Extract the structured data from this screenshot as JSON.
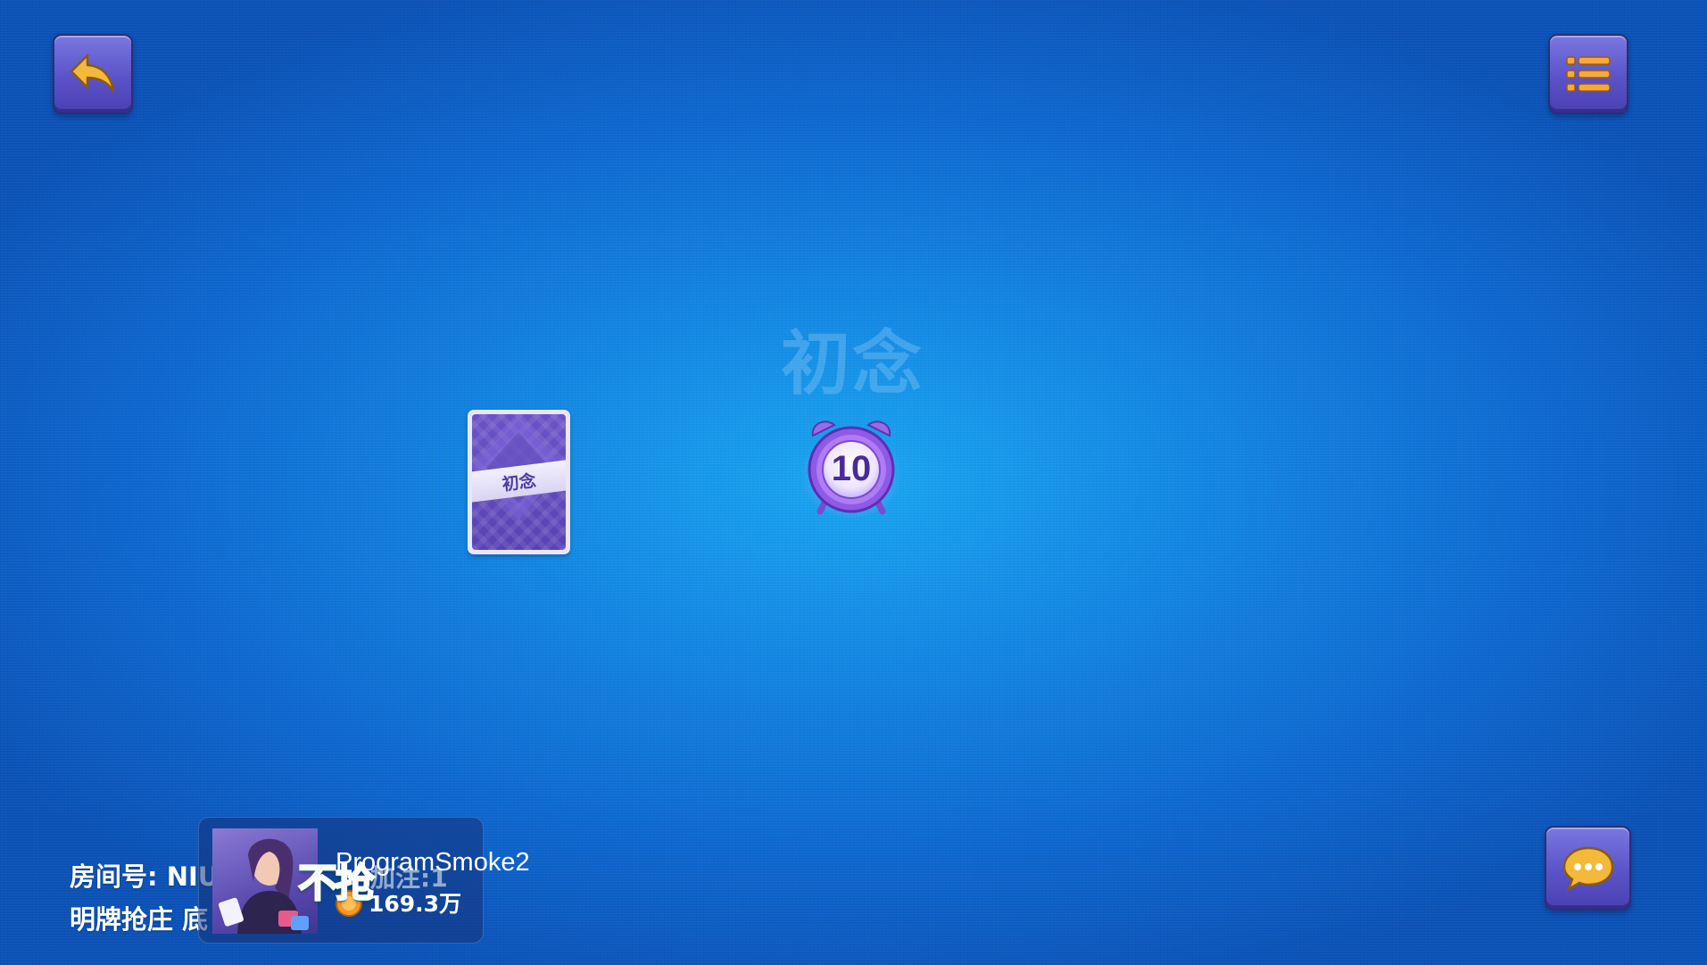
{
  "table": {
    "watermark": "初念"
  },
  "buttons": {
    "back_icon": "back-arrow-icon",
    "menu_icon": "menu-list-icon",
    "chat_icon": "chat-bubble-icon"
  },
  "card": {
    "back_label": "初念"
  },
  "timer": {
    "seconds": "10"
  },
  "room": {
    "id_line": "房间号: NIU",
    "mode_line": "明牌抢庄 底"
  },
  "player": {
    "name": "ProgramSmoke2",
    "coins": "169.3万",
    "action_label": "不抢",
    "hidden_label": "加注:1"
  },
  "colors": {
    "button_purple": "#5a53c8",
    "table_blue": "#1386e3",
    "bid_green": "#36d8a8",
    "back_arrow": "#f4b93a"
  }
}
